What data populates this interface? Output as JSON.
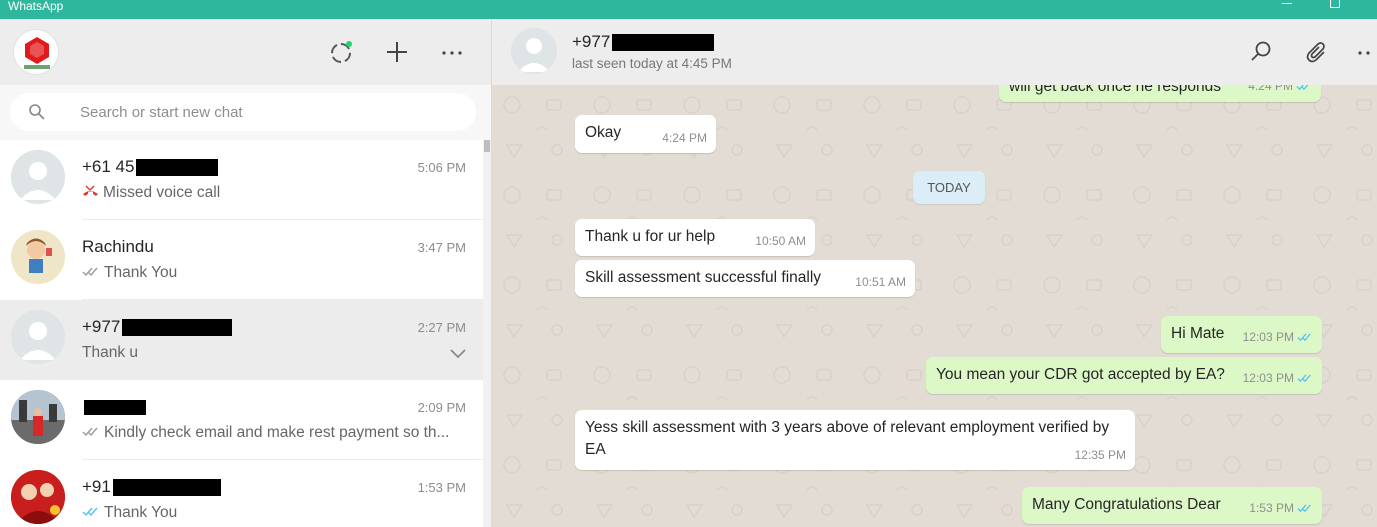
{
  "window": {
    "title": "WhatsApp"
  },
  "search": {
    "placeholder": "Search or start new chat"
  },
  "chats": [
    {
      "name": "+61 45",
      "time": "5:06 PM",
      "preview": "Missed voice call"
    },
    {
      "name": "Rachindu",
      "time": "3:47 PM",
      "preview": "Thank You"
    },
    {
      "name": "+977",
      "time": "2:27 PM",
      "preview": "Thank u"
    },
    {
      "name": "",
      "time": "2:09 PM",
      "preview": "Kindly check email and make rest payment so th..."
    },
    {
      "name": "+91",
      "time": "1:53 PM",
      "preview": "Thank You"
    }
  ],
  "conversation": {
    "contact_name": "+977",
    "status": "last seen today at 4:45 PM",
    "day_label": "TODAY",
    "messages": [
      {
        "text": "will get back once he responds",
        "time": "4:24 PM"
      },
      {
        "text": "Okay",
        "time": "4:24 PM"
      },
      {
        "text": "Thank u for ur help",
        "time": "10:50 AM"
      },
      {
        "text": "Skill assessment successful finally",
        "time": "10:51 AM"
      },
      {
        "text": "Hi Mate",
        "time": "12:03 PM"
      },
      {
        "text": "You mean your CDR got accepted by EA?",
        "time": "12:03 PM"
      },
      {
        "text": "Yess skill assessment with 3 years above of relevant employment verified by EA",
        "time": "12:35 PM"
      },
      {
        "text": "Many Congratulations Dear",
        "time": "1:53 PM"
      }
    ]
  },
  "colors": {
    "titlebar": "#2fb79d",
    "outgoing_bubble": "#dcf8c6",
    "incoming_bubble": "#ffffff",
    "read_tick": "#4fc3f7",
    "missed_call": "#e53935"
  },
  "icons": {
    "header_left": [
      "status-icon",
      "new-chat-icon",
      "menu-icon"
    ],
    "header_right": [
      "search-icon",
      "attach-icon",
      "menu-icon"
    ]
  }
}
